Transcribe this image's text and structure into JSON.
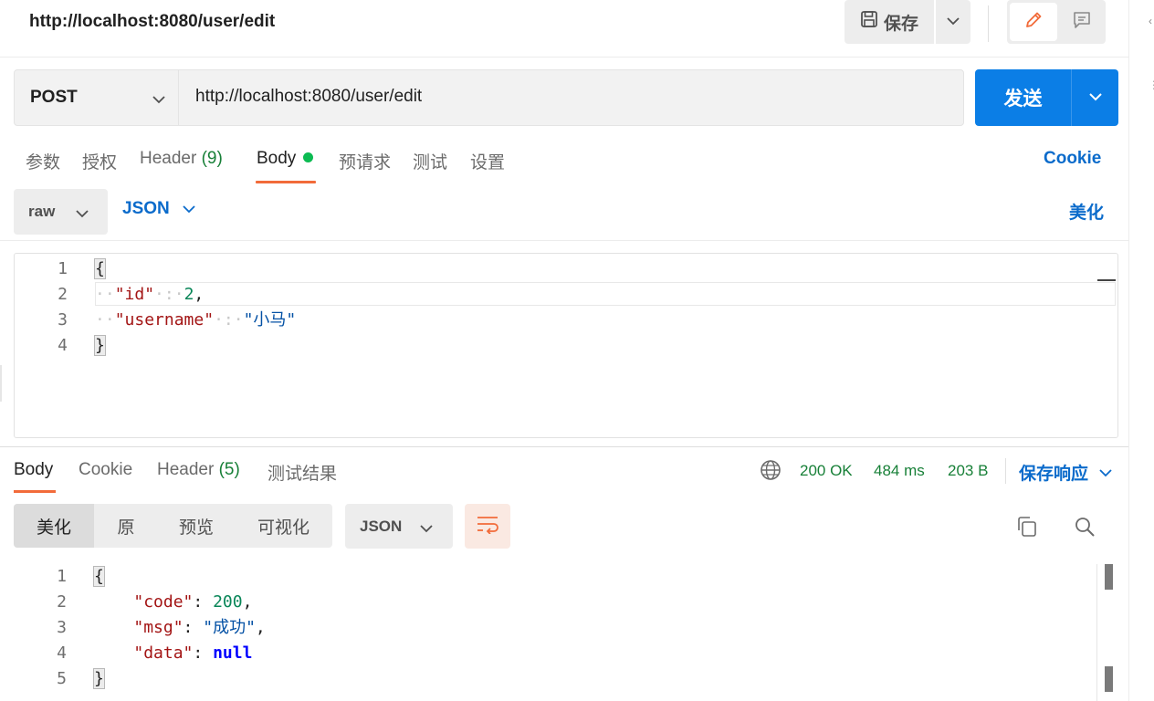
{
  "header": {
    "title": "http://localhost:8080/user/edit",
    "save_label": "保存",
    "rail_glyph": "⋮"
  },
  "request": {
    "method": "POST",
    "url": "http://localhost:8080/user/edit",
    "send_label": "发送"
  },
  "req_tabs": {
    "params": "参数",
    "auth": "授权",
    "header": "Header",
    "header_count": "(9)",
    "body": "Body",
    "prerequest": "预请求",
    "tests": "测试",
    "settings": "设置",
    "cookie": "Cookie"
  },
  "body_options": {
    "raw": "raw",
    "format": "JSON",
    "beautify": "美化"
  },
  "request_body": {
    "line_numbers": [
      "1",
      "2",
      "3",
      "4"
    ],
    "open": "{",
    "indent": "··",
    "colon_sp": "·:·",
    "key_id": "\"id\"",
    "val_id": "2",
    "comma": ",",
    "key_username": "\"username\"",
    "val_username": "\"小马\"",
    "close": "}"
  },
  "resp_tabs": {
    "body": "Body",
    "cookie": "Cookie",
    "header": "Header",
    "header_count": "(5)",
    "test_results": "测试结果"
  },
  "resp_status": {
    "status": "200 OK",
    "time": "484 ms",
    "size": "203 B",
    "save_response": "保存响应"
  },
  "resp_view": {
    "pretty": "美化",
    "raw": "原",
    "preview": "预览",
    "visualize": "可视化",
    "format": "JSON"
  },
  "response_body": {
    "line_numbers": [
      "1",
      "2",
      "3",
      "4",
      "5"
    ],
    "open": "{",
    "key_code": "\"code\"",
    "val_code": "200",
    "key_msg": "\"msg\"",
    "val_msg": "\"成功\"",
    "key_data": "\"data\"",
    "val_data": "null",
    "colon": ": ",
    "comma": ",",
    "close": "}"
  },
  "colors": {
    "accent_blue": "#0b7ee6",
    "link_blue": "#0b6bcb",
    "tab_underline": "#f26b3a",
    "success_green": "#188038",
    "body_dot": "#0cbb52"
  },
  "icons": [
    "save-icon",
    "chevron-down-icon",
    "pencil-icon",
    "comment-icon",
    "globe-icon",
    "wrap-lines-icon",
    "copy-icon",
    "search-icon"
  ]
}
